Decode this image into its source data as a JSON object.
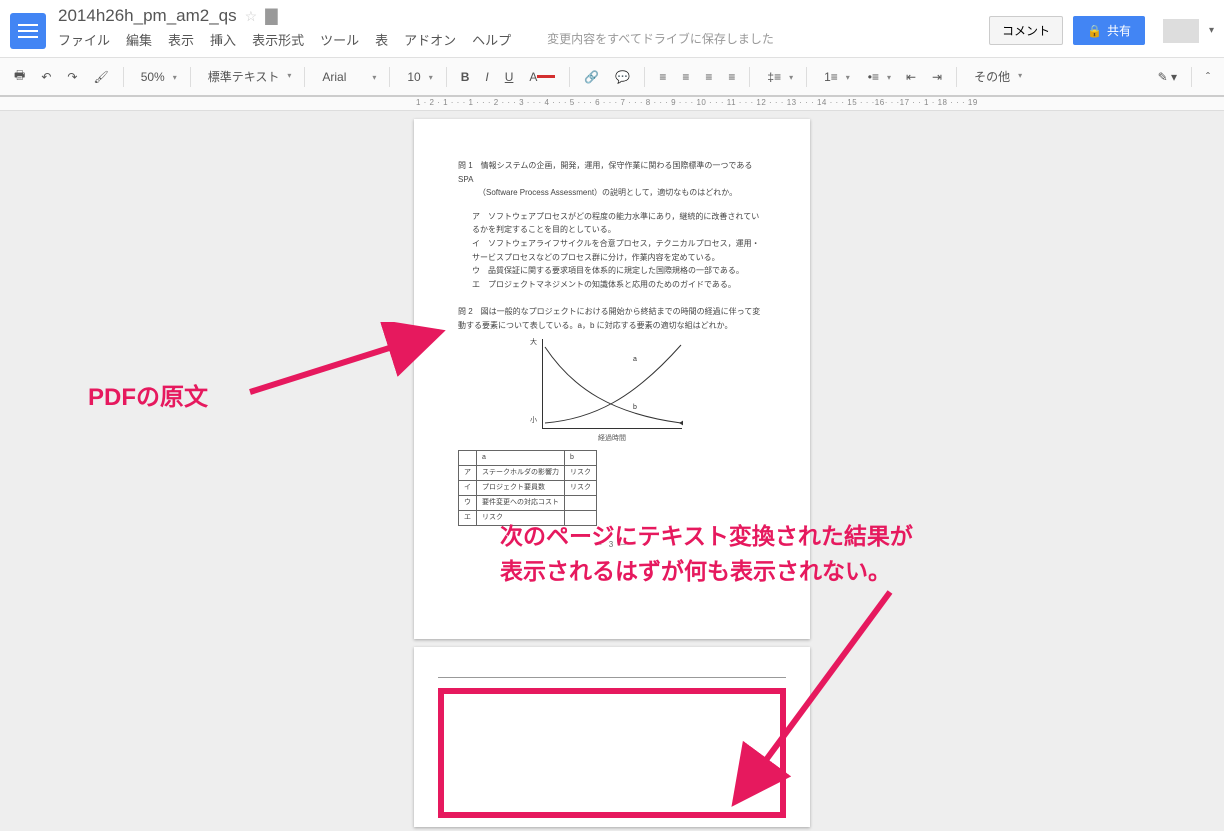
{
  "header": {
    "title": "2014h26h_pm_am2_qs",
    "menus": [
      "ファイル",
      "編集",
      "表示",
      "挿入",
      "表示形式",
      "ツール",
      "表",
      "アドオン",
      "ヘルプ"
    ],
    "save_status": "変更内容をすべてドライブに保存しました",
    "comment_btn": "コメント",
    "share_btn": "共有"
  },
  "toolbar": {
    "zoom": "50%",
    "style": "標準テキスト",
    "font": "Arial",
    "size": "10",
    "more": "その他"
  },
  "ruler": "1 · 2 · 1 · · · 1 · · · 2 · · · 3 · · · 4 · · · 5 · · · 6 · · · 7 · · · 8 · · · 9 · · · 10 · · · 11 · · · 12 · · · 13 · · · 14 · · · 15 · · ·16· · ·17 · ·  1 · 18 · · · 19",
  "doc": {
    "q1_head": "問 1　情報システムの企画，開発，運用，保守作業に関わる国際標準の一つである SPA",
    "q1_sub": "（Software Process Assessment）の説明として，適切なものはどれか。",
    "q1_a": "ア　ソフトウェアプロセスがどの程度の能力水準にあり，継続的に改善されているかを判定することを目的としている。",
    "q1_i": "イ　ソフトウェアライフサイクルを合意プロセス，テクニカルプロセス，運用・サービスプロセスなどのプロセス群に分け，作業内容を定めている。",
    "q1_u": "ウ　品質保証に関する要求項目を体系的に規定した国際規格の一部である。",
    "q1_e": "エ　プロジェクトマネジメントの知識体系と応用のためのガイドである。",
    "q2_head": "問 2　図は一般的なプロジェクトにおける開始から終結までの時間の経過に伴って変動する要素について表している。a，b に対応する要素の適切な組はどれか。",
    "chart_xlabel": "経過時間",
    "table": {
      "head_a": "a",
      "head_b": "b",
      "rows": [
        [
          "ア",
          "ステークホルダの影響力",
          "リスク"
        ],
        [
          "イ",
          "プロジェクト要員数",
          "リスク"
        ],
        [
          "ウ",
          "要件変更への対応コスト",
          ""
        ],
        [
          "エ",
          "リスク",
          ""
        ]
      ]
    },
    "page_no": "－ 3 －"
  },
  "anno": {
    "label1": "PDFの原文",
    "label2_l1": "次のページにテキスト変換された結果が",
    "label2_l2": "表示されるはずが何も表示されない。"
  },
  "chart_data": {
    "type": "line",
    "title": "",
    "xlabel": "経過時間",
    "ylabel": "大 … 小",
    "x": [
      0,
      1,
      2,
      3,
      4,
      5,
      6,
      7,
      8,
      9,
      10
    ],
    "series": [
      {
        "name": "a",
        "values": [
          10,
          6,
          4,
          2.5,
          1.8,
          1.3,
          1,
          0.8,
          0.6,
          0.5,
          0.4
        ]
      },
      {
        "name": "b",
        "values": [
          0.3,
          0.5,
          0.8,
          1.2,
          1.8,
          2.5,
          3.5,
          5,
          6.5,
          8,
          10
        ]
      }
    ],
    "xlim": [
      0,
      10
    ],
    "ylim": [
      0,
      10
    ]
  }
}
